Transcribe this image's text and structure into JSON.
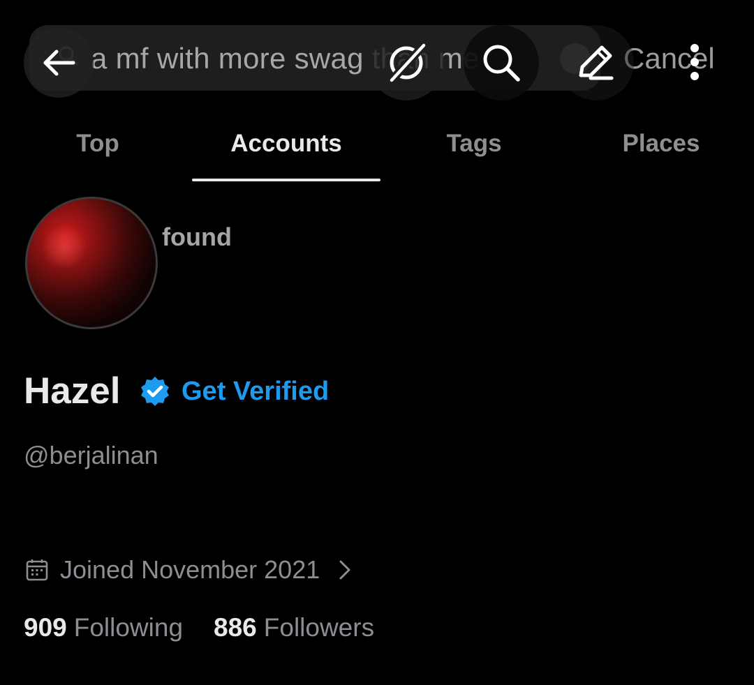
{
  "search": {
    "query": "a mf with more swag than me",
    "cancel_label": "Cancel"
  },
  "overlay_icons": {
    "back": "arrow-left-icon",
    "grok_off": "grok-slash-icon",
    "search": "search-icon",
    "compose": "pencil-icon",
    "more": "more-vertical-icon"
  },
  "tabs": [
    {
      "label": "Top",
      "active": false
    },
    {
      "label": "Accounts",
      "active": true
    },
    {
      "label": "Tags",
      "active": false
    },
    {
      "label": "Places",
      "active": false
    }
  ],
  "profile": {
    "avatar_caption": "found",
    "display_name": "Hazel",
    "verified_badge": "verified-badge-icon",
    "get_verified_label": "Get Verified",
    "handle": "@berjalinan",
    "joined": "Joined November 2021",
    "following_count": "909",
    "following_label": "Following",
    "followers_count": "886",
    "followers_label": "Followers"
  },
  "colors": {
    "background": "#000000",
    "accent_blue": "#1d9bf0",
    "text_primary": "#e7e9ea",
    "text_secondary": "#8b8f93"
  }
}
